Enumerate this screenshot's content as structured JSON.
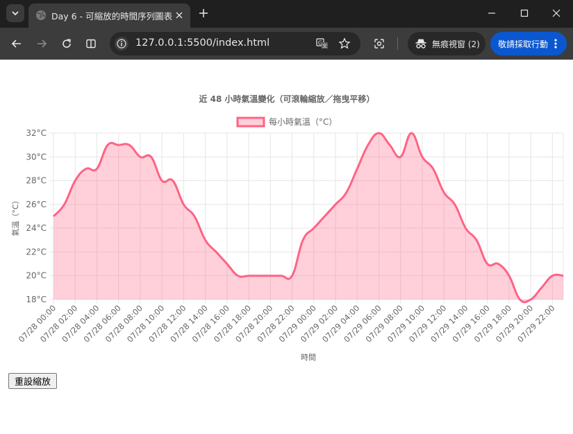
{
  "browser": {
    "tab_title": "Day 6 - 可縮放的時間序列圖表",
    "url": "127.0.0.1:5500/index.html",
    "incognito_label": "無痕視窗 (2)",
    "action_label": "敬請採取行動",
    "icons": [
      "tab-search-icon",
      "globe-icon",
      "close-icon",
      "plus-icon",
      "minimize-icon",
      "maximize-icon",
      "back-icon",
      "forward-icon",
      "reload-icon",
      "split-view-icon",
      "site-info-icon",
      "translate-icon",
      "star-icon",
      "lens-icon",
      "incognito-icon",
      "more-icon"
    ]
  },
  "page": {
    "reset_button": "重設縮放"
  },
  "colors": {
    "line": "#ff6384",
    "fill": "rgba(255,99,132,0.3)",
    "grid": "#e5e5e5",
    "text": "#666666",
    "browser_dark": "#1f1f1f",
    "toolbar": "#3c3c3c",
    "action_blue": "#0b57d0"
  },
  "chart_data": {
    "type": "area",
    "title": "近 48 小時氣溫變化（可滾輪縮放／拖曳平移）",
    "xlabel": "時間",
    "ylabel": "氣溫（°C）",
    "ylim": [
      18,
      32
    ],
    "y_ticks": [
      "18°C",
      "20°C",
      "22°C",
      "24°C",
      "26°C",
      "28°C",
      "30°C",
      "32°C"
    ],
    "grid": true,
    "legend_position": "top",
    "x_tick_labels": [
      "07/28 00:00",
      "07/28 02:00",
      "07/28 04:00",
      "07/28 06:00",
      "07/28 08:00",
      "07/28 10:00",
      "07/28 12:00",
      "07/28 14:00",
      "07/28 16:00",
      "07/28 18:00",
      "07/28 20:00",
      "07/28 22:00",
      "07/29 00:00",
      "07/29 02:00",
      "07/29 04:00",
      "07/29 06:00",
      "07/29 08:00",
      "07/29 10:00",
      "07/29 12:00",
      "07/29 14:00",
      "07/29 16:00",
      "07/29 18:00",
      "07/29 20:00",
      "07/29 22:00"
    ],
    "series": [
      {
        "name": "每小時氣溫（°C）",
        "x": [
          "07/28 00:00",
          "07/28 01:00",
          "07/28 02:00",
          "07/28 03:00",
          "07/28 04:00",
          "07/28 05:00",
          "07/28 06:00",
          "07/28 07:00",
          "07/28 08:00",
          "07/28 09:00",
          "07/28 10:00",
          "07/28 11:00",
          "07/28 12:00",
          "07/28 13:00",
          "07/28 14:00",
          "07/28 15:00",
          "07/28 16:00",
          "07/28 17:00",
          "07/28 18:00",
          "07/28 19:00",
          "07/28 20:00",
          "07/28 21:00",
          "07/28 22:00",
          "07/28 23:00",
          "07/29 00:00",
          "07/29 01:00",
          "07/29 02:00",
          "07/29 03:00",
          "07/29 04:00",
          "07/29 05:00",
          "07/29 06:00",
          "07/29 07:00",
          "07/29 08:00",
          "07/29 09:00",
          "07/29 10:00",
          "07/29 11:00",
          "07/29 12:00",
          "07/29 13:00",
          "07/29 14:00",
          "07/29 15:00",
          "07/29 16:00",
          "07/29 17:00",
          "07/29 18:00",
          "07/29 19:00",
          "07/29 20:00",
          "07/29 21:00",
          "07/29 22:00",
          "07/29 23:00"
        ],
        "values": [
          25,
          26,
          28,
          29,
          29,
          31,
          31,
          31,
          30,
          30,
          28,
          28,
          26,
          25,
          23,
          22,
          21,
          20,
          20,
          20,
          20,
          20,
          20,
          23,
          24,
          25,
          26,
          27,
          29,
          31,
          32,
          31,
          30,
          32,
          30,
          29,
          27,
          26,
          24,
          23,
          21,
          21,
          20,
          18,
          18,
          19,
          20,
          20
        ]
      }
    ]
  }
}
